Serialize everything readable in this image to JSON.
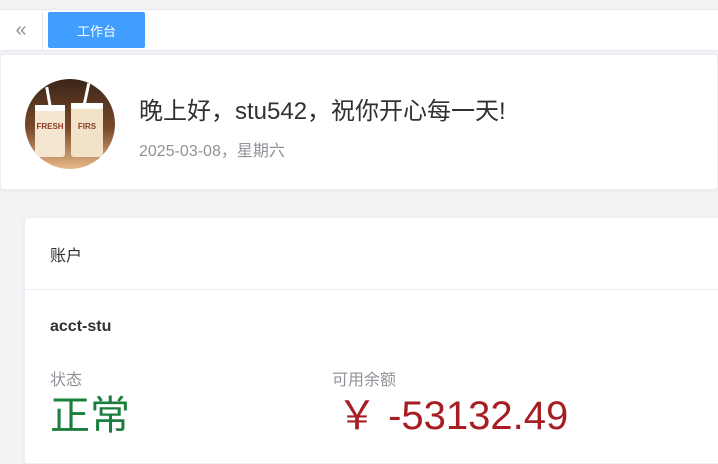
{
  "tabbar": {
    "collapse_icon": "«",
    "active_tab": "工作台"
  },
  "greeting": {
    "title": "晚上好，stu542，祝你开心每一天!",
    "date": "2025-03-08，星期六",
    "avatar_text_1": "FRESH",
    "avatar_text_2": "FIRS"
  },
  "account": {
    "header": "账户",
    "name": "acct-stu",
    "status_label": "状态",
    "status_value": "正常",
    "balance_label": "可用余额",
    "balance_value": "￥ -53132.49"
  },
  "colors": {
    "accent": "#409eff",
    "status_green": "#1a7f3c",
    "balance_red": "#a61d24"
  }
}
